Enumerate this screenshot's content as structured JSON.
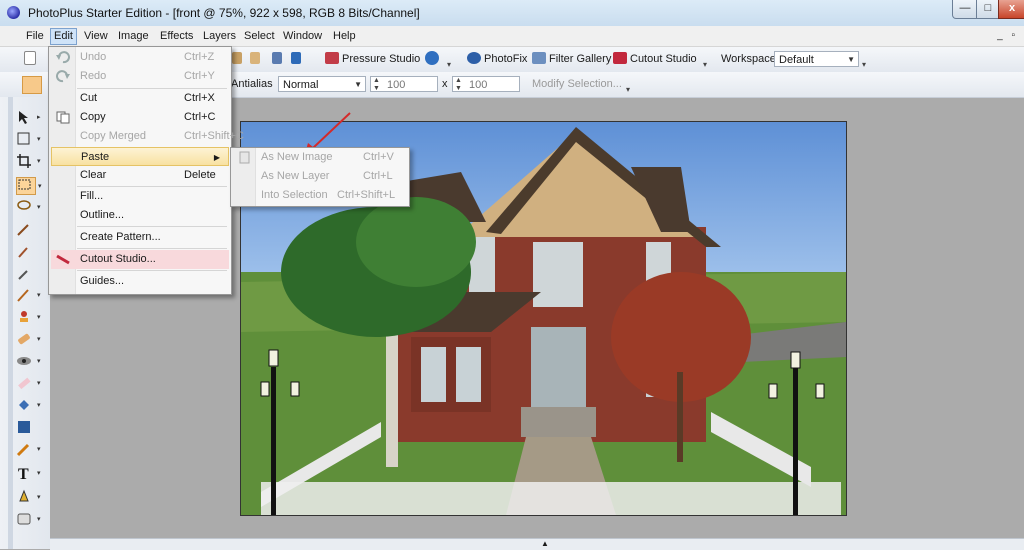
{
  "window": {
    "title": "PhotoPlus Starter Edition - [front @ 75%, 922 x 598, RGB 8 Bits/Channel]",
    "min_label": "—",
    "max_label": "□",
    "close_label": "x"
  },
  "menubar": {
    "items": [
      {
        "label": "File"
      },
      {
        "label": "Edit"
      },
      {
        "label": "View"
      },
      {
        "label": "Image"
      },
      {
        "label": "Effects"
      },
      {
        "label": "Layers"
      },
      {
        "label": "Select"
      },
      {
        "label": "Window"
      },
      {
        "label": "Help"
      }
    ],
    "mdi": "_ ▫"
  },
  "toolbar1": {
    "pressure_studio": "Pressure Studio",
    "photofix": "PhotoFix",
    "filter_gallery": "Filter Gallery",
    "cutout_studio": "Cutout Studio",
    "workspace_label": "Workspace",
    "workspace_value": "Default"
  },
  "toolbar2": {
    "antialias": "Antialias",
    "blend_mode": "Normal",
    "width_value": "100",
    "height_value": "100",
    "times": "x",
    "modify_selection": "Modify Selection..."
  },
  "edit_menu": {
    "items": [
      {
        "label": "Undo",
        "shortcut": "Ctrl+Z",
        "disabled": true
      },
      {
        "label": "Redo",
        "shortcut": "Ctrl+Y",
        "disabled": true
      },
      {
        "label": "Cut",
        "shortcut": "Ctrl+X",
        "disabled": false
      },
      {
        "label": "Copy",
        "shortcut": "Ctrl+C",
        "disabled": false
      },
      {
        "label": "Copy Merged",
        "shortcut": "Ctrl+Shift+C",
        "disabled": true
      },
      {
        "label": "Paste",
        "shortcut": "",
        "disabled": false,
        "submenu": true
      },
      {
        "label": "Clear",
        "shortcut": "Delete",
        "disabled": false
      },
      {
        "label": "Fill...",
        "shortcut": "",
        "disabled": false
      },
      {
        "label": "Outline...",
        "shortcut": "",
        "disabled": false
      },
      {
        "label": "Create Pattern...",
        "shortcut": "",
        "disabled": false
      },
      {
        "label": "Cutout Studio...",
        "shortcut": "",
        "disabled": false
      },
      {
        "label": "Guides...",
        "shortcut": "",
        "disabled": false
      }
    ],
    "submenu_arrow": "▶"
  },
  "paste_submenu": {
    "items": [
      {
        "label": "As New Image",
        "shortcut": "Ctrl+V"
      },
      {
        "label": "As New Layer",
        "shortcut": "Ctrl+L"
      },
      {
        "label": "Into Selection",
        "shortcut": "Ctrl+Shift+L"
      }
    ]
  },
  "colors": {
    "cutout_highlight": "#f8d9dc",
    "menu_highlight": "#f8e1a1",
    "annotation_arrow": "#d42a2a"
  }
}
